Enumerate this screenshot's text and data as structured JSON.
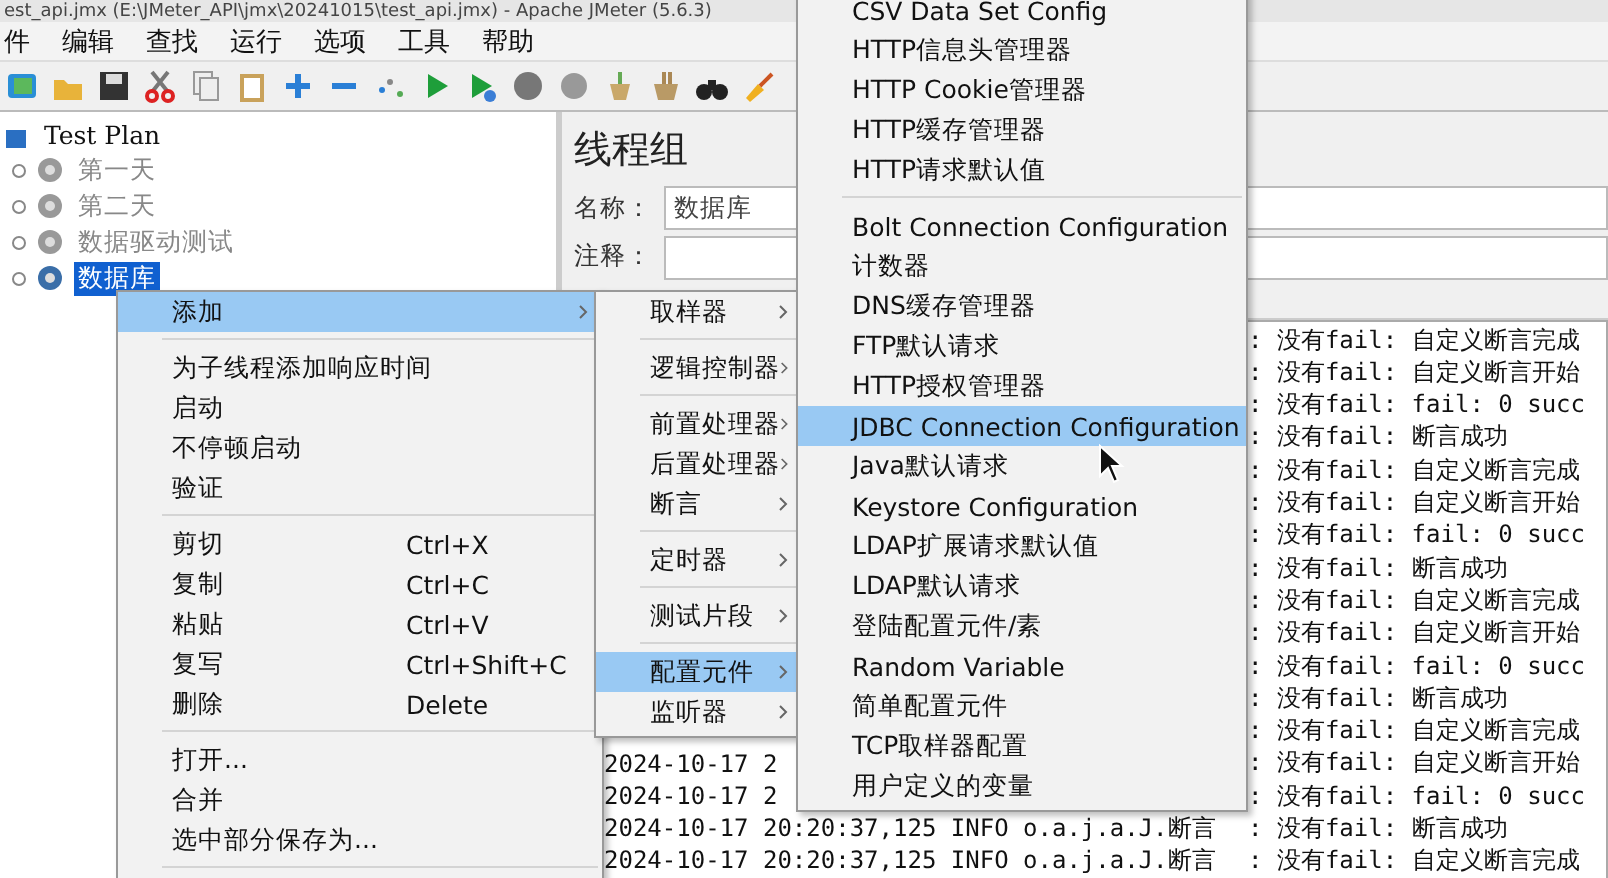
{
  "window": {
    "title": "est_api.jmx (E:\\JMeter_API\\jmx\\20241015\\test_api.jmx) - Apache JMeter (5.6.3)"
  },
  "menubar": [
    "件",
    "编辑",
    "查找",
    "运行",
    "选项",
    "工具",
    "帮助"
  ],
  "tree": {
    "items": [
      {
        "label": "Test Plan",
        "disabled": false,
        "selected": false,
        "children": [
          {
            "label": "第一天",
            "disabled": true,
            "selected": false
          },
          {
            "label": "第二天",
            "disabled": true,
            "selected": false
          },
          {
            "label": "数据驱动测试",
            "disabled": true,
            "selected": false
          },
          {
            "label": "数据库",
            "disabled": false,
            "selected": true
          }
        ]
      }
    ]
  },
  "panel": {
    "title": "线程组",
    "fields": [
      {
        "label": "名称：",
        "value": "数据库"
      },
      {
        "label": "注释："
      }
    ]
  },
  "log": {
    "lines": [
      {
        "right": ": 没有fail: 自定义断言完成"
      },
      {
        "right": ": 没有fail: 自定义断言开始"
      },
      {
        "right": ": 没有fail: fail: 0  succ"
      },
      {
        "right": ": 没有fail: 断言成功"
      },
      {
        "right": ": 没有fail: 自定义断言完成"
      },
      {
        "right": ": 没有fail: 自定义断言开始"
      },
      {
        "right": ": 没有fail: fail: 0  succ"
      },
      {
        "right": ": 没有fail: 断言成功"
      },
      {
        "right": ": 没有fail: 自定义断言完成"
      },
      {
        "right": ": 没有fail: 自定义断言开始"
      },
      {
        "right": ": 没有fail: fail: 0  succ"
      },
      {
        "right": ": 没有fail: 断言成功"
      },
      {
        "right": ": 没有fail: 自定义断言完成"
      },
      {
        "left": "2024-10-17 2",
        "right": ": 没有fail: 自定义断言开始"
      },
      {
        "left": "2024-10-17 2",
        "right": ": 没有fail: fail: 0  succ"
      },
      {
        "left": "2024-10-17 20:20:37,125 INFO o.a.j.a.J.断言",
        "right": ": 没有fail: 断言成功"
      },
      {
        "left": "2024-10-17 20:20:37,125 INFO o.a.j.a.J.断言",
        "right": ": 没有fail: 自定义断言完成"
      }
    ]
  },
  "context_menu": {
    "items": [
      {
        "kind": "item",
        "label": "添加",
        "has_submenu": true,
        "selected": true
      },
      {
        "kind": "separator"
      },
      {
        "kind": "item",
        "label": "为子线程添加响应时间",
        "has_submenu": false,
        "selected": false
      },
      {
        "kind": "item",
        "label": "启动",
        "has_submenu": false,
        "selected": false
      },
      {
        "kind": "item",
        "label": "不停顿启动",
        "has_submenu": false,
        "selected": false
      },
      {
        "kind": "item",
        "label": "验证",
        "has_submenu": false,
        "selected": false
      },
      {
        "kind": "separator"
      },
      {
        "kind": "item",
        "label": "剪切",
        "shortcut": "Ctrl+X",
        "has_submenu": false,
        "selected": false
      },
      {
        "kind": "item",
        "label": "复制",
        "shortcut": "Ctrl+C",
        "has_submenu": false,
        "selected": false
      },
      {
        "kind": "item",
        "label": "粘贴",
        "shortcut": "Ctrl+V",
        "has_submenu": false,
        "selected": false
      },
      {
        "kind": "item",
        "label": "复写",
        "shortcut": "Ctrl+Shift+C",
        "has_submenu": false,
        "selected": false
      },
      {
        "kind": "item",
        "label": "删除",
        "shortcut": "Delete",
        "has_submenu": false,
        "selected": false
      },
      {
        "kind": "separator"
      },
      {
        "kind": "item",
        "label": "打开...",
        "has_submenu": false,
        "selected": false
      },
      {
        "kind": "item",
        "label": "合并",
        "has_submenu": false,
        "selected": false
      },
      {
        "kind": "item",
        "label": "选中部分保存为...",
        "has_submenu": false,
        "selected": false
      },
      {
        "kind": "separator"
      }
    ]
  },
  "add_submenu": {
    "items": [
      {
        "kind": "item",
        "label": "取样器",
        "has_submenu": true,
        "selected": false
      },
      {
        "kind": "separator"
      },
      {
        "kind": "item",
        "label": "逻辑控制器",
        "has_submenu": true,
        "selected": false
      },
      {
        "kind": "separator"
      },
      {
        "kind": "item",
        "label": "前置处理器",
        "has_submenu": true,
        "selected": false
      },
      {
        "kind": "item",
        "label": "后置处理器",
        "has_submenu": true,
        "selected": false
      },
      {
        "kind": "item",
        "label": "断言",
        "has_submenu": true,
        "selected": false
      },
      {
        "kind": "separator"
      },
      {
        "kind": "item",
        "label": "定时器",
        "has_submenu": true,
        "selected": false
      },
      {
        "kind": "separator"
      },
      {
        "kind": "item",
        "label": "测试片段",
        "has_submenu": true,
        "selected": false
      },
      {
        "kind": "separator"
      },
      {
        "kind": "item",
        "label": "配置元件",
        "has_submenu": true,
        "selected": true
      },
      {
        "kind": "item",
        "label": "监听器",
        "has_submenu": true,
        "selected": false
      }
    ]
  },
  "config_submenu": {
    "items": [
      {
        "kind": "item",
        "label": "CSV Data Set Config",
        "selected": false
      },
      {
        "kind": "item",
        "label": "HTTP信息头管理器",
        "selected": false
      },
      {
        "kind": "item",
        "label": "HTTP Cookie管理器",
        "selected": false
      },
      {
        "kind": "item",
        "label": "HTTP缓存管理器",
        "selected": false
      },
      {
        "kind": "item",
        "label": "HTTP请求默认值",
        "selected": false
      },
      {
        "kind": "separator"
      },
      {
        "kind": "item",
        "label": "Bolt Connection Configuration",
        "selected": false
      },
      {
        "kind": "item",
        "label": "计数器",
        "selected": false
      },
      {
        "kind": "item",
        "label": "DNS缓存管理器",
        "selected": false
      },
      {
        "kind": "item",
        "label": "FTP默认请求",
        "selected": false
      },
      {
        "kind": "item",
        "label": "HTTP授权管理器",
        "selected": false
      },
      {
        "kind": "item",
        "label": "JDBC Connection Configuration",
        "selected": true
      },
      {
        "kind": "item",
        "label": "Java默认请求",
        "selected": false
      },
      {
        "kind": "item",
        "label": "Keystore Configuration",
        "selected": false
      },
      {
        "kind": "item",
        "label": "LDAP扩展请求默认值",
        "selected": false
      },
      {
        "kind": "item",
        "label": "LDAP默认请求",
        "selected": false
      },
      {
        "kind": "item",
        "label": "登陆配置元件/素",
        "selected": false
      },
      {
        "kind": "item",
        "label": "Random Variable",
        "selected": false
      },
      {
        "kind": "item",
        "label": "简单配置元件",
        "selected": false
      },
      {
        "kind": "item",
        "label": "TCP取样器配置",
        "selected": false
      },
      {
        "kind": "item",
        "label": "用户定义的变量",
        "selected": false
      }
    ]
  }
}
